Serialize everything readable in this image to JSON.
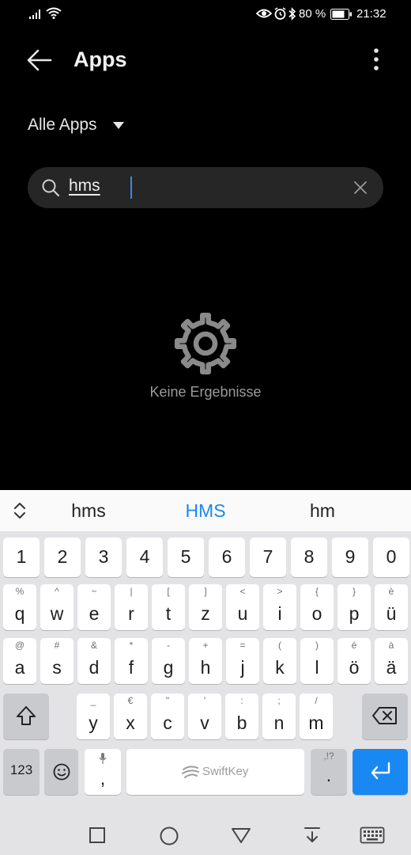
{
  "status_bar": {
    "battery": "80 %",
    "time": "21:32"
  },
  "header": {
    "title": "Apps",
    "filter_label": "Alle Apps"
  },
  "search": {
    "query": "hms"
  },
  "empty_state": {
    "message": "Keine Ergebnisse"
  },
  "keyboard": {
    "suggestions": [
      "hms",
      "HMS",
      "hm"
    ],
    "highlight_color": "#1a88f2",
    "number_row": [
      "1",
      "2",
      "3",
      "4",
      "5",
      "6",
      "7",
      "8",
      "9",
      "0"
    ],
    "row1": {
      "main": [
        "q",
        "w",
        "e",
        "r",
        "t",
        "z",
        "u",
        "i",
        "o",
        "p",
        "ü"
      ],
      "sub": [
        "%",
        "^",
        "~",
        "|",
        "[",
        "]",
        "<",
        ">",
        "{",
        "}",
        "è"
      ]
    },
    "row2": {
      "main": [
        "a",
        "s",
        "d",
        "f",
        "g",
        "h",
        "j",
        "k",
        "l",
        "ö",
        "ä"
      ],
      "sub": [
        "@",
        "#",
        "&",
        "*",
        "-",
        "+",
        "=",
        "(",
        ")",
        "é",
        "à"
      ]
    },
    "row3": {
      "main": [
        "y",
        "x",
        "c",
        "v",
        "b",
        "n",
        "m"
      ],
      "sub": [
        "_",
        "€",
        "\"",
        "'",
        ":",
        ";",
        "/"
      ]
    },
    "symbols_label": "123",
    "comma": ",",
    "period": ".",
    "period_sub": ",!?",
    "space_brand": "SwiftKey"
  }
}
